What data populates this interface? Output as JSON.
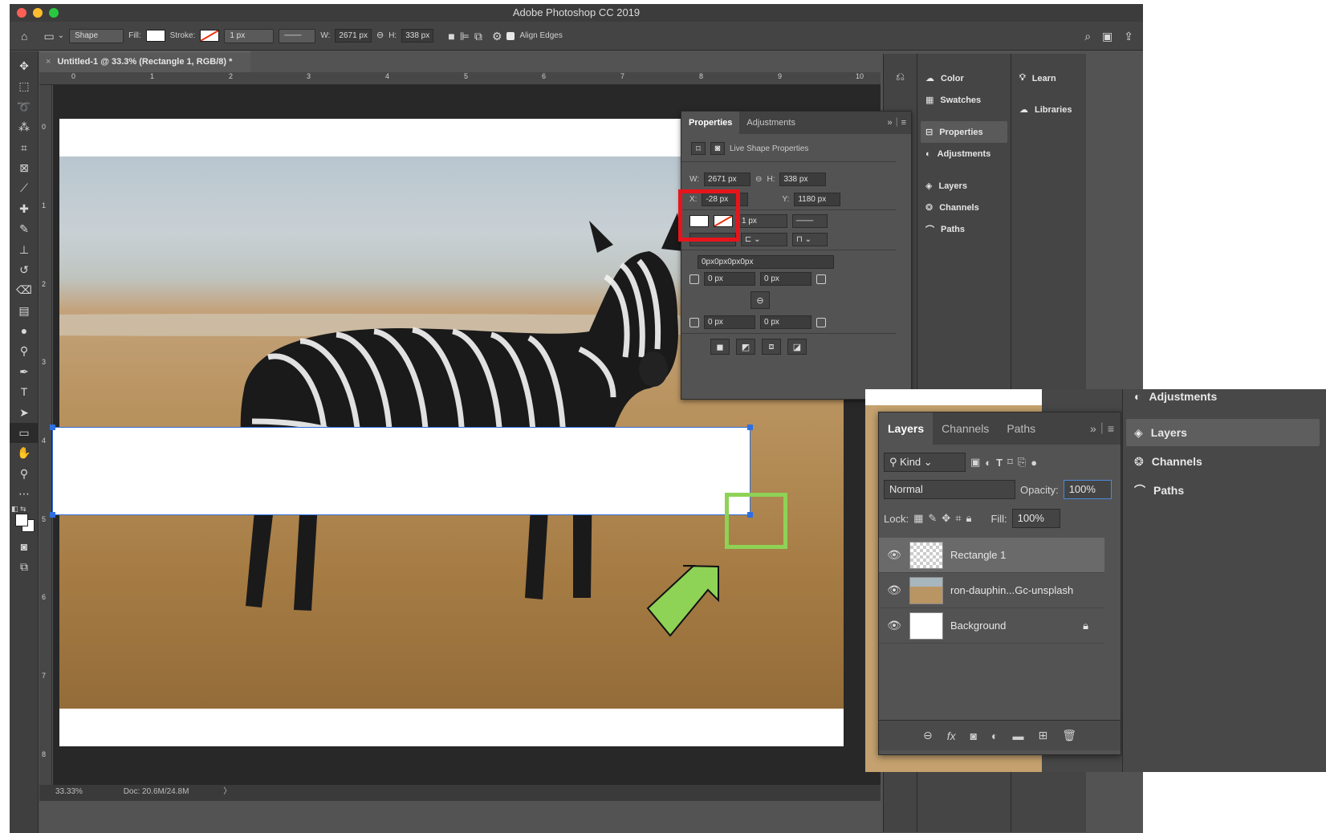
{
  "app": {
    "title": "Adobe Photoshop CC 2019",
    "doc_tab": "Untitled-1 @ 33.3% (Rectangle 1, RGB/8) *",
    "zoom_readout": "33.33%",
    "doc_info": "Doc: 20.6M/24.8M"
  },
  "optbar": {
    "mode": "Shape",
    "fill_label": "Fill:",
    "stroke_label": "Stroke:",
    "stroke_width": "1 px",
    "w_label": "W:",
    "w_value": "2671 px",
    "h_label": "H:",
    "h_value": "338 px",
    "align_edges": "Align Edges"
  },
  "ruler": {
    "h_ticks": [
      "0",
      "1",
      "2",
      "3",
      "4",
      "5",
      "6",
      "7",
      "8",
      "9",
      "10"
    ],
    "v_ticks": [
      "0",
      "1",
      "2",
      "3",
      "4",
      "5",
      "6",
      "7",
      "8"
    ]
  },
  "dock": {
    "col1": [
      "Color",
      "Swatches",
      "Properties",
      "Adjustments",
      "Layers",
      "Channels",
      "Paths"
    ],
    "col2": [
      "Learn",
      "Libraries"
    ]
  },
  "properties": {
    "tabs": [
      "Properties",
      "Adjustments"
    ],
    "header": "Live Shape Properties",
    "w_label": "W:",
    "w": "2671 px",
    "h_label": "H:",
    "h": "338 px",
    "x_label": "X:",
    "x": "-28 px",
    "y_label": "Y:",
    "y": "1180 px",
    "stroke_width": "1 px",
    "corners_text": "0px0px0px0px",
    "corner_tl": "0 px",
    "corner_tr": "0 px",
    "corner_bl": "0 px",
    "corner_br": "0 px"
  },
  "layers_panel": {
    "tabs": [
      "Layers",
      "Channels",
      "Paths"
    ],
    "filter": "Kind",
    "blend": "Normal",
    "opacity_label": "Opacity:",
    "opacity": "100%",
    "lock_label": "Lock:",
    "fill_label": "Fill:",
    "fill": "100%",
    "layers": [
      "Rectangle 1",
      "ron-dauphin...Gc-unsplash",
      "Background"
    ]
  },
  "zoom_dock": [
    "Adjustments",
    "Layers",
    "Channels",
    "Paths"
  ],
  "colors": {
    "highlight_red": "#e8141b",
    "highlight_green": "#8ed256",
    "selection_blue": "#2f6fe0"
  }
}
